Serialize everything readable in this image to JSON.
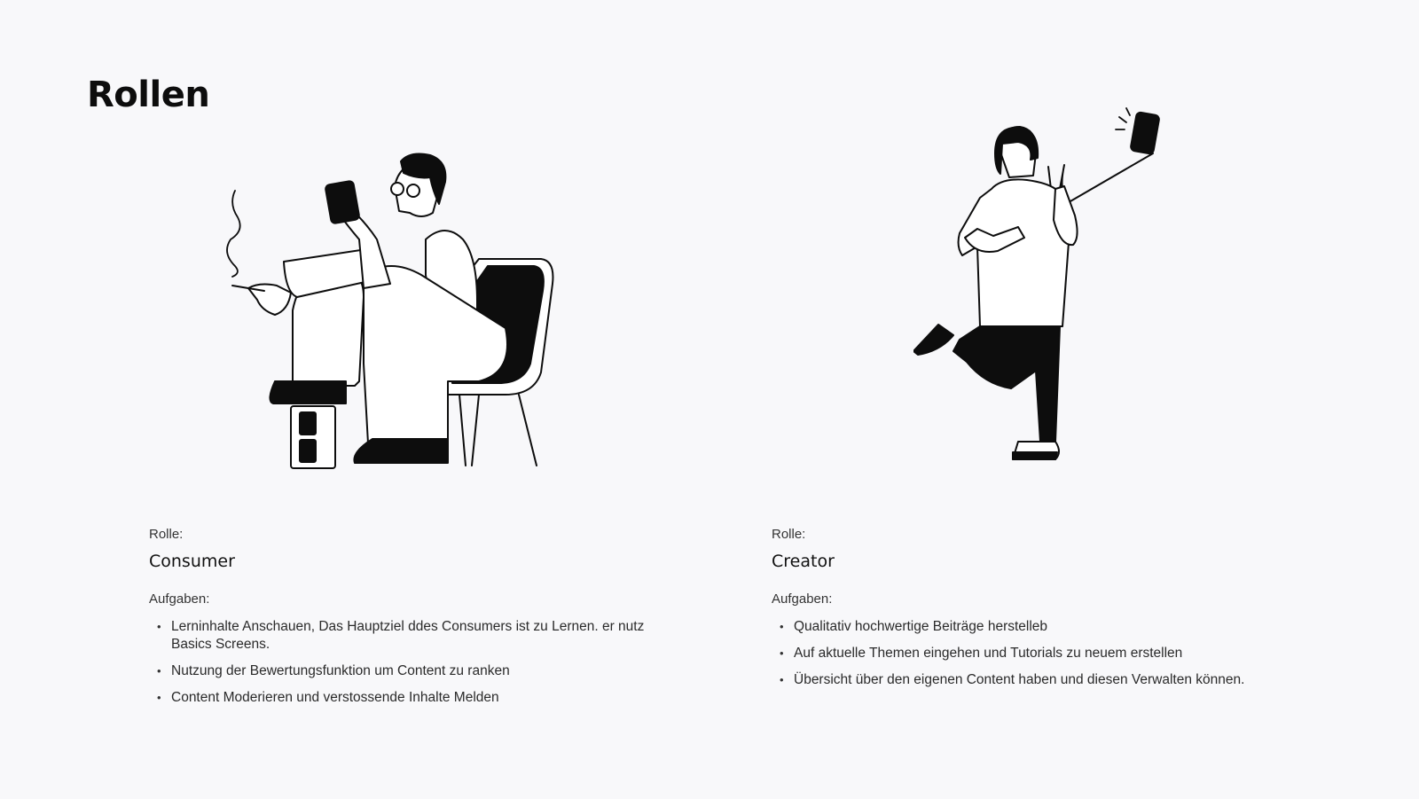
{
  "page": {
    "title": "Rollen"
  },
  "roles": [
    {
      "role_label": "Rolle:",
      "name": "Consumer",
      "tasks_label": "Aufgaben:",
      "illustration_icon": "person-sitting-phone-illustration",
      "tasks": [
        "Lerninhalte Anschauen, Das Hauptziel ddes Consumers ist zu Lernen. er nutz Basics Screens.",
        "Nutzung der Bewertungsfunktion um Content zu ranken",
        "Content Moderieren und verstossende Inhalte Melden"
      ]
    },
    {
      "role_label": "Rolle:",
      "name": "Creator",
      "tasks_label": "Aufgaben:",
      "illustration_icon": "person-selfie-stick-illustration",
      "tasks": [
        "Qualitativ hochwertige Beiträge herstelleb",
        "Auf aktuelle Themen eingehen und Tutorials zu neuem erstellen",
        "Übersicht über den eigenen Content haben und diesen Verwalten können."
      ]
    }
  ],
  "colors": {
    "background": "#f8f8fa",
    "ink": "#0d0d0d"
  }
}
